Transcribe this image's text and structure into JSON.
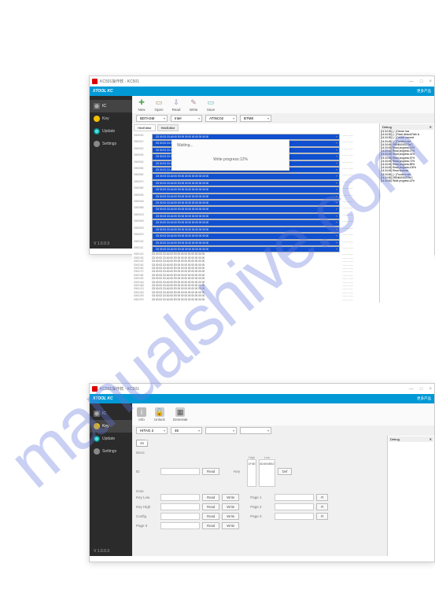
{
  "watermark": "manualshive.com",
  "window1": {
    "title": "KC501操作软 - KC501",
    "titlebar_buttons": {
      "min": "—",
      "max": "□",
      "close": "×"
    },
    "brand": "XTOOL KC",
    "brand_right": "更多产品",
    "sidebar": {
      "items": [
        {
          "icon": "ic",
          "label": "IC",
          "active": true
        },
        {
          "icon": "key",
          "label": "Key"
        },
        {
          "icon": "update",
          "label": "Update"
        },
        {
          "icon": "settings",
          "label": "Settings"
        }
      ],
      "version": "V 1.0.0.3"
    },
    "toolbar": {
      "new": "New",
      "open": "Open",
      "read": "Read",
      "write": "Write",
      "save": "Save"
    },
    "selects": {
      "s1": "BDTASM",
      "s2": "Intel",
      "s3": "ATINC02",
      "s4": "BTM8"
    },
    "hex_tabs": {
      "editor": "HexEditor",
      "other": "HexEditor"
    },
    "hex_addr_prefix": "0000",
    "hex_bytes_row": "C5 00 03 C0 A0 00 E0 00 00 00 00 00 00 00 00",
    "hex_ascii_row": "................",
    "progress": {
      "label": "Waiting...",
      "text": "Write progress:12%"
    },
    "debug": {
      "header": "Debug",
      "lines": [
        "[14:34:30] [✓] Device has",
        "[14:34:30] [✓] Read default,Path is",
        "[14:34:30] [✓] Device connect",
        "[14:34:45] [✓] Function set",
        "[14:34:45] [*BIN64000270s*]",
        "[14:34:45] Read progress:12%",
        "[14:34:45] Read progress:27%",
        "[14:34:45] Read progress:41%",
        "[14:34:45] Read progress:57%",
        "[14:34:45] Read progress:72%",
        "[14:34:45] Read progress:85%",
        "[14:34:45] Read progress:100%",
        "[14:34:45] Read success",
        "[14:34:50] [✓] Function set",
        "[14:34:50] [*BIN64000270s*]",
        "[14:34:50] Write progress:12%"
      ]
    }
  },
  "window2": {
    "title": "KC501操作软 - KC501",
    "brand": "XTOOL KC",
    "brand_right": "更多产品",
    "sidebar": {
      "items": [
        {
          "icon": "ic",
          "label": "IC"
        },
        {
          "icon": "key",
          "label": "Key",
          "active": true
        },
        {
          "icon": "update",
          "label": "Update"
        },
        {
          "icon": "settings",
          "label": "Settings"
        }
      ],
      "version": "V 1.0.0.3"
    },
    "toolbar": {
      "info": "Info",
      "unlock": "Unlock",
      "generate": "Generate"
    },
    "selects": {
      "s1": "HITAG 2",
      "s2": "46"
    },
    "chip_tab": "46",
    "debug_header": "Debug",
    "form": {
      "basic_label": "Basic",
      "data_label": "Data",
      "id_label": "ID",
      "key_label": "Key",
      "high_label": "High",
      "high_val": "1F4E",
      "low_label": "Low",
      "low_val": "4D494B52",
      "def_label": "Def",
      "keylow_label": "Key Low",
      "keyhigh_label": "Key High",
      "config_label": "Config",
      "page0_label": "Page 0",
      "page1_label": "Page 1",
      "page2_label": "Page 2",
      "page3_label": "Page 3",
      "read": "Read",
      "write": "Write",
      "r": "R"
    }
  }
}
